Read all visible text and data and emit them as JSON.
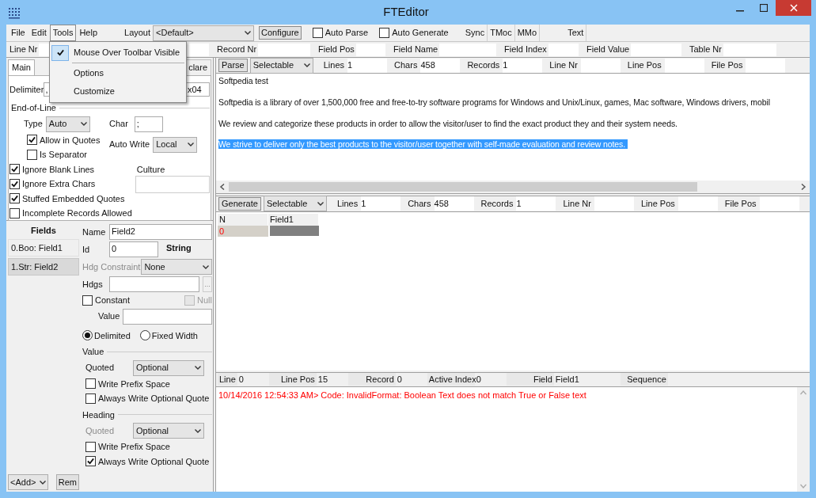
{
  "window": {
    "title": "FTEditor"
  },
  "menu_bar": [
    {
      "label": "File",
      "selected": false
    },
    {
      "label": "Edit",
      "selected": false
    },
    {
      "label": "Tools",
      "selected": true
    },
    {
      "label": "Help",
      "selected": false
    }
  ],
  "tools_menu": [
    {
      "label": "Mouse Over Toolbar Visible",
      "checked": true
    },
    {
      "label": "Options",
      "checked": false
    },
    {
      "label": "Customize",
      "checked": false
    }
  ],
  "toolbar": {
    "layout_label": "Layout",
    "layout_value": "<Default>",
    "configure": "Configure",
    "checks": [
      {
        "label": "Auto Parse",
        "checked": false
      },
      {
        "label": "Auto Generate",
        "checked": false
      }
    ],
    "buttons": [
      "Sync",
      "TMoc",
      "MMo",
      "Text"
    ]
  },
  "info_bar": [
    {
      "label": "Line Nr"
    },
    {
      "label": "Record Nr"
    },
    {
      "label": "Field Pos"
    },
    {
      "label": "Field Name"
    },
    {
      "label": "Field Index"
    },
    {
      "label": "Field Value"
    },
    {
      "label": "Table Nr"
    }
  ],
  "left_tabs": [
    {
      "label": "Main",
      "selected": true
    },
    {
      "label": "clare",
      "selected": false
    }
  ],
  "delimiter": {
    "label": "Delimiter",
    "value": ",",
    "second_value": "x04"
  },
  "eol": {
    "title": "End-of-Line",
    "type_label": "Type",
    "type_value": "Auto",
    "char_label": "Char",
    "char_value": ";",
    "checks": [
      {
        "label": "Allow in Quotes",
        "checked": true
      },
      {
        "label": "Is Separator",
        "checked": false
      }
    ],
    "auto_write_label": "Auto Write",
    "auto_write_value": "Local"
  },
  "options": [
    {
      "label": "Ignore Blank Lines",
      "checked": true
    },
    {
      "label": "Ignore Extra Chars",
      "checked": true
    },
    {
      "label": "Stuffed Embedded Quotes",
      "checked": true
    },
    {
      "label": "Incomplete Records Allowed",
      "checked": false
    }
  ],
  "culture_label": "Culture",
  "fields": {
    "title": "Fields",
    "items": [
      {
        "label": "0.Boo: Field1",
        "selected": false
      },
      {
        "label": "1.Str: Field2",
        "selected": true
      }
    ],
    "add": "<Add>",
    "remove": "Rem"
  },
  "field_editor": {
    "name_label": "Name",
    "name_value": "Field2",
    "id_label": "Id",
    "id_value": "0",
    "type": "String",
    "hdg_constraint_label": "Hdg Constraint",
    "hdg_constraint_disabled": true,
    "hdg_constraint_value": "None",
    "hdgs_label": "Hdgs",
    "browse": "...",
    "constant": {
      "label": "Constant",
      "checked": false
    },
    "null": {
      "label": "Null",
      "checked": false,
      "disabled": true
    },
    "value_label": "Value",
    "radios": [
      {
        "label": "Delimited",
        "selected": true
      },
      {
        "label": "Fixed Width",
        "selected": false
      }
    ],
    "value_group": {
      "title": "Value",
      "quoted_label": "Quoted",
      "quoted_disabled": false,
      "quoted_value": "Optional",
      "checks": [
        {
          "label": "Write Prefix Space",
          "checked": false
        },
        {
          "label": "Always Write Optional Quote",
          "checked": false
        }
      ]
    },
    "heading_group": {
      "title": "Heading",
      "quoted_label": "Quoted",
      "quoted_disabled": true,
      "quoted_value": "Optional",
      "checks": [
        {
          "label": "Write Prefix Space",
          "checked": false
        },
        {
          "label": "Always Write Optional Quote",
          "checked": true
        }
      ]
    }
  },
  "parse_bar": {
    "button": "Parse",
    "mode": "Selectable",
    "stats": [
      {
        "label": "Lines",
        "value": "1"
      },
      {
        "label": "Chars",
        "value": "458"
      },
      {
        "label": "Records",
        "value": "1"
      },
      {
        "label": "Line Nr"
      },
      {
        "label": "Line Pos"
      },
      {
        "label": "File Pos"
      }
    ]
  },
  "text": [
    {
      "text": "Softpedia test",
      "selected": false
    },
    {
      "text": "Softpedia is a library of over 1,500,000 free and free-to-try software programs for Windows and Unix/Linux, games, Mac software, Windows drivers, mobil",
      "selected": false
    },
    {
      "text": "We review and categorize these products in order to allow the visitor/user to find the exact product they and their system needs.",
      "selected": false
    },
    {
      "text": "We strive to deliver only the best products to the visitor/user together with self-made evaluation and review notes. ",
      "selected": true
    }
  ],
  "generate_bar": {
    "button": "Generate",
    "mode": "Selectable",
    "stats": [
      {
        "label": "Lines",
        "value": "1"
      },
      {
        "label": "Chars",
        "value": "458"
      },
      {
        "label": "Records",
        "value": "1"
      },
      {
        "label": "Line Nr"
      },
      {
        "label": "Line Pos"
      },
      {
        "label": "File Pos"
      }
    ]
  },
  "grid": {
    "columns": [
      "N",
      "Field1"
    ],
    "rows": [
      {
        "n": "0",
        "selected": true
      }
    ]
  },
  "status": [
    {
      "label": "Line",
      "value": "0"
    },
    {
      "label": "Line Pos",
      "value": "15"
    },
    {
      "label": "Record",
      "value": "0"
    },
    {
      "label": "Active Index",
      "value": "0"
    },
    {
      "label": "Field",
      "value": "Field1"
    },
    {
      "label": "Sequence"
    }
  ],
  "log": "10/14/2016 12:54:33 AM> Code: InvalidFormat: Boolean Text does not match True or False text"
}
